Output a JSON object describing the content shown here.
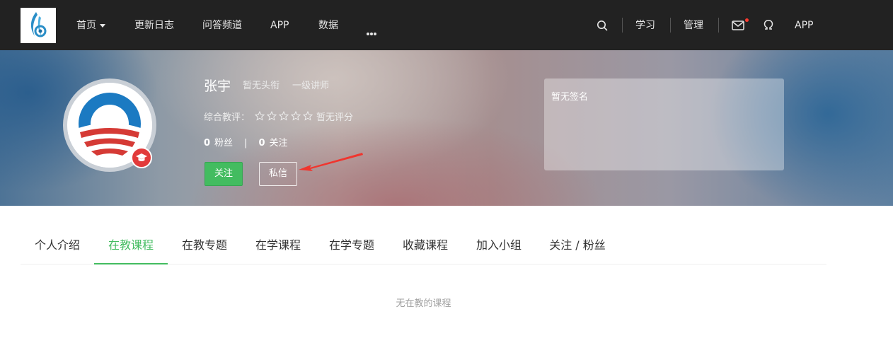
{
  "nav": {
    "items": [
      {
        "label": "首页",
        "dropdown": true
      },
      {
        "label": "更新日志"
      },
      {
        "label": "问答频道"
      },
      {
        "label": "APP"
      },
      {
        "label": "数据"
      }
    ],
    "right": {
      "study": "学习",
      "manage": "管理",
      "app": "APP"
    },
    "icons": [
      "search-icon",
      "mail-icon",
      "user-icon",
      "more-icon"
    ]
  },
  "profile": {
    "name": "张宇",
    "headline": "暂无头衔",
    "level": "一级讲师",
    "rating_label": "综合教评：",
    "rating_stars": 5,
    "rating_text": "暂无评分",
    "fans_count": "0",
    "fans_label": "粉丝",
    "following_count": "0",
    "following_label": "关注",
    "follow_button": "关注",
    "message_button": "私信",
    "signature": "暂无签名"
  },
  "tabs": [
    {
      "label": "个人介绍",
      "active": false
    },
    {
      "label": "在教课程",
      "active": true
    },
    {
      "label": "在教专题",
      "active": false
    },
    {
      "label": "在学课程",
      "active": false
    },
    {
      "label": "在学专题",
      "active": false
    },
    {
      "label": "收藏课程",
      "active": false
    },
    {
      "label": "加入小组",
      "active": false
    },
    {
      "label": "关注 / 粉丝",
      "active": false
    }
  ],
  "empty_message": "无在教的课程",
  "colors": {
    "nav_bg": "#222222",
    "accent_green": "#43bc60",
    "badge_red": "#e23b3b",
    "arrow_red": "#f0352e"
  }
}
